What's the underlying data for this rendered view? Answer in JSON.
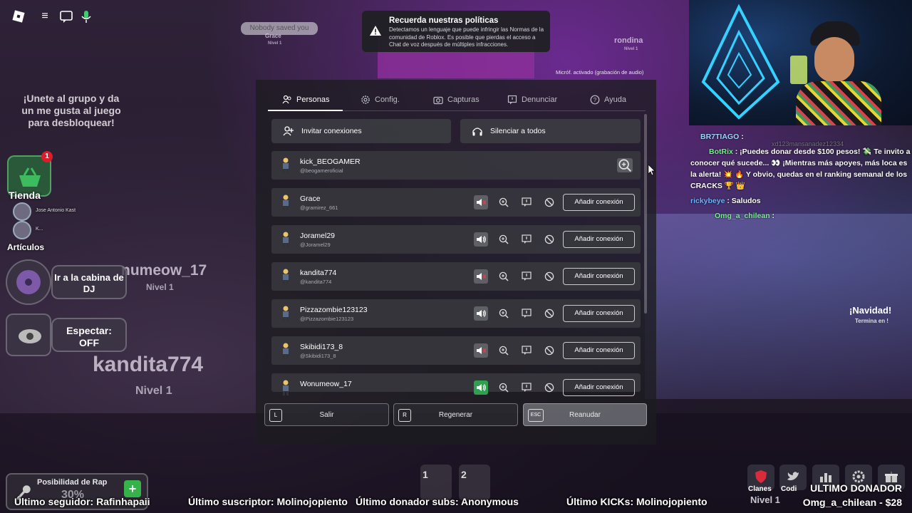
{
  "toast": {
    "title": "Recuerda nuestras políticas",
    "body": "Detectamos un lenguaje que puede infringir las Normas de la comunidad de Roblox. Es posible que pierdas el acceso a Chat de voz después de múltiples infracciones."
  },
  "mic_note": "Micróf. activado (grabación de audio)",
  "world": {
    "bubble": "Nobody saved you",
    "grace_top": "Grace",
    "grace_top_level": "Nivel 1",
    "rondina": "rondina",
    "rondina_level": "Nivel 1",
    "wonumeow": "numeow_17",
    "wonumeow_level": "Nivel 1",
    "kandita": "kandita774",
    "kandita_level": "Nivel 1",
    "navidad": "¡Navidad!",
    "navidad_sub": "Termina en !",
    "sign_text": "¡Unete al grupo y da un me gusta al juego para desbloquear!"
  },
  "sidebar": {
    "shop_label": "Tienda",
    "shop_badge": "1",
    "player1": "Jose Antonio Kast",
    "player2": "K...",
    "articles_label": "Artículos",
    "dj_label": "Ir a la cabina de DJ",
    "spectate_label": "Espectar: OFF"
  },
  "tabs": [
    {
      "label": "Personas",
      "icon": "people-icon"
    },
    {
      "label": "Config.",
      "icon": "gear-icon"
    },
    {
      "label": "Capturas",
      "icon": "camera-icon"
    },
    {
      "label": "Denunciar",
      "icon": "flag-icon"
    },
    {
      "label": "Ayuda",
      "icon": "help-icon"
    }
  ],
  "actions": {
    "invite": "Invitar conexiones",
    "mute_all": "Silenciar a todos"
  },
  "players": [
    {
      "name": "kick_BEOGAMER",
      "handle": "@beogameroficial",
      "self": true
    },
    {
      "name": "Grace",
      "handle": "@gramirez_661",
      "muted": true,
      "add": "Añadir conexión"
    },
    {
      "name": "Joramel29",
      "handle": "@Joramel29",
      "muted": false,
      "add": "Añadir conexión"
    },
    {
      "name": "kandita774",
      "handle": "@kandita774",
      "muted": true,
      "add": "Añadir conexión"
    },
    {
      "name": "Pizzazombie123123",
      "handle": "@Pizzazombie123123",
      "muted": false,
      "add": "Añadir conexión"
    },
    {
      "name": "Skibidi173_8",
      "handle": "@Skibidi173_8",
      "muted": true,
      "add": "Añadir conexión"
    },
    {
      "name": "Wonumeow_17",
      "handle": "",
      "muted": false,
      "speaking": true,
      "add": "Añadir conexión"
    }
  ],
  "bottom": {
    "leave_key": "L",
    "leave": "Salir",
    "reset_key": "R",
    "reset": "Regenerar",
    "resume_key": "ESC",
    "resume": "Reanudar"
  },
  "chat": [
    {
      "user": "BR7TIAGO",
      "text": ":",
      "color": "#9fd3ff"
    },
    {
      "user": "BotRix",
      "text": ": ¡Puedes donar desde $100 pesos! 💸 Te invito a conocer qué sucede... 👀 ¡Mientras más apoyes, más loca es la alerta! 💥 🔥 Y obvio, quedas en el ranking semanal de los CRACKS 🏆 👑",
      "color": "#6ef58a"
    },
    {
      "user": "rickybeye",
      "text": ": Saludos",
      "color": "#6fb4ff"
    },
    {
      "user": "Omg_a_chilean",
      "text": ":",
      "color": "#6ef58a"
    }
  ],
  "chat_bg_name": "xd123mansanadez12334",
  "hud": {
    "rap_label": "Posibilidad de Rap",
    "rap_value": "30%",
    "follower": "Último seguidor: Rafinhapaii",
    "subscriber": "Último suscriptor: Molinojopiento",
    "sub_donor": "Último donador subs: Anonymous",
    "kicks": "Último KICKs: Molinojopiento",
    "donor_title": "ULTIMO DONADOR",
    "donor_value": "Omg_a_chilean - $28",
    "slot1": "1",
    "slot2": "2",
    "clans": "Clanes",
    "codes": "Codi",
    "nivel_right": "Nivel 1"
  },
  "colors": {
    "accent_green": "#2ea04f",
    "panel_bg": "#1c1c20",
    "mute_red": "#e0414c"
  }
}
